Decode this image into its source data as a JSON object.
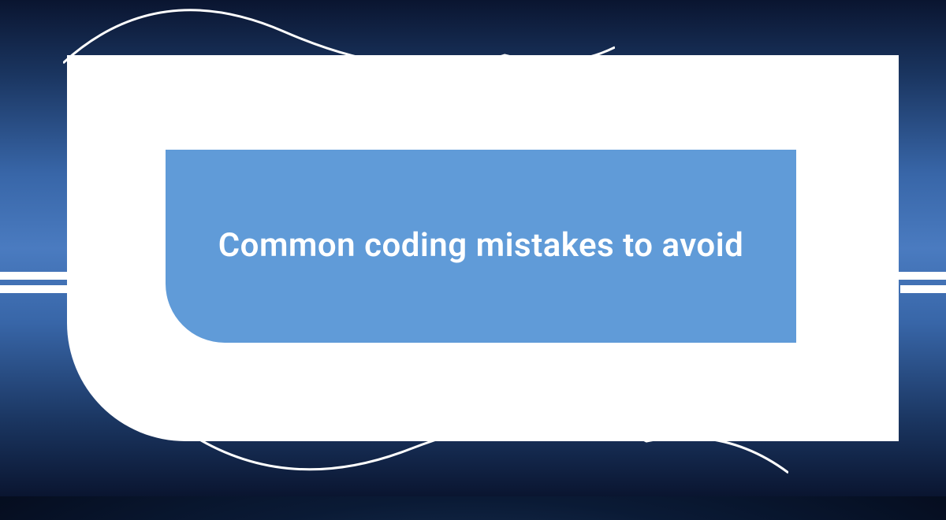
{
  "title": "Common coding mistakes to avoid",
  "colors": {
    "inner_box": "#609bd8",
    "outer_frame": "#ffffff",
    "text": "#ffffff"
  }
}
